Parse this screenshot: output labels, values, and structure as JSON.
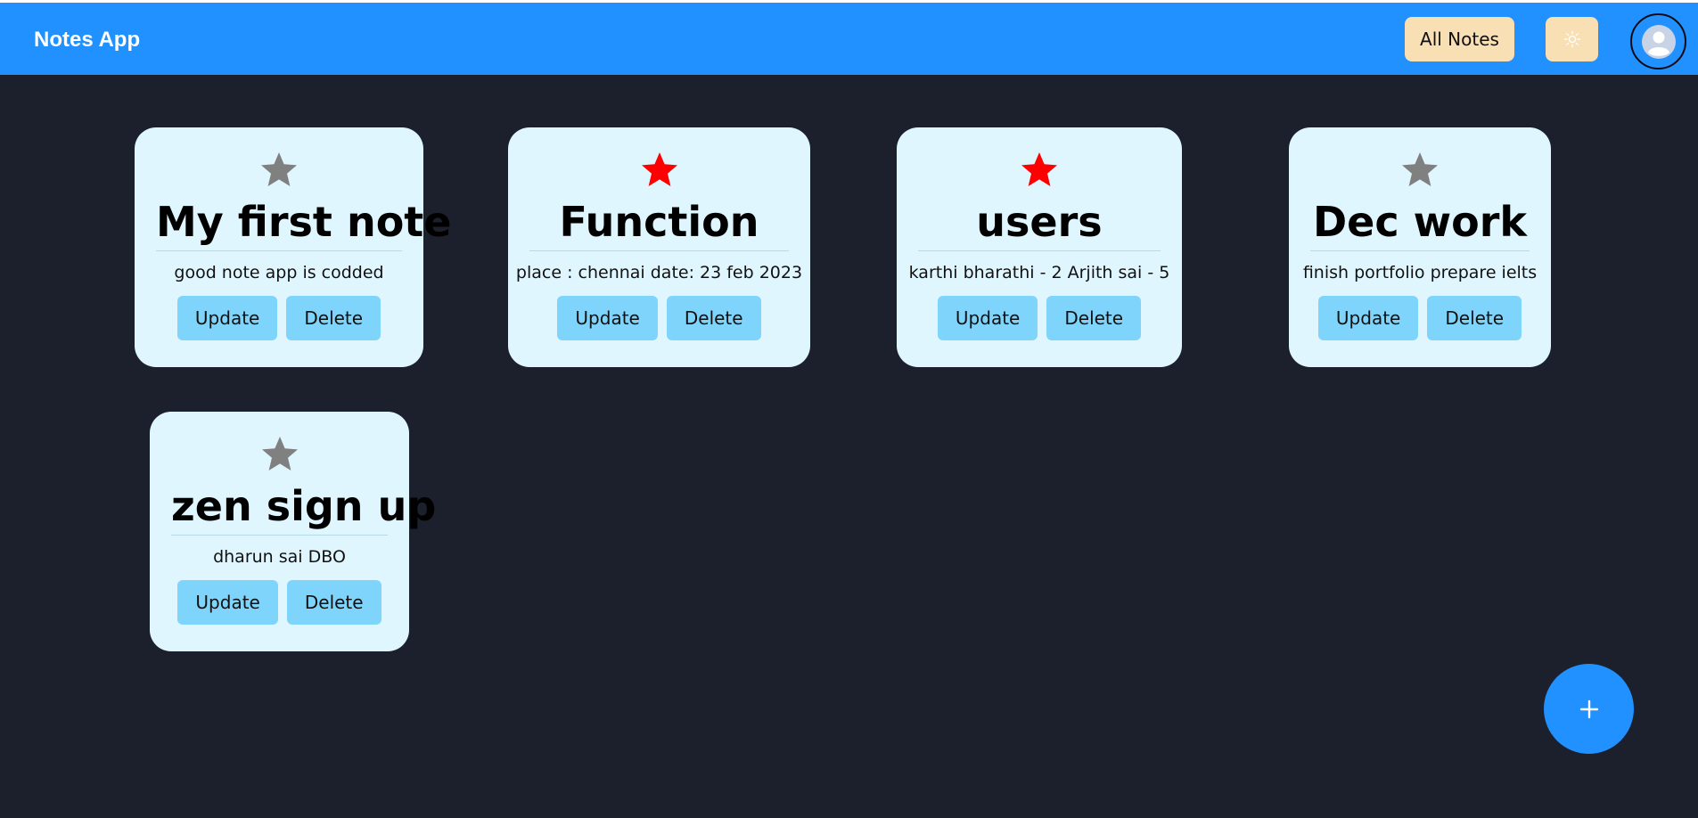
{
  "header": {
    "brand": "Notes App",
    "all_notes_label": "All Notes",
    "theme_icon": "sun-icon",
    "avatar_icon": "user-avatar-icon"
  },
  "notes": [
    {
      "title": "My first note",
      "description": "good note app is codded",
      "starred": false,
      "update_label": "Update",
      "delete_label": "Delete"
    },
    {
      "title": "Function",
      "description": "place : chennai date: 23 feb 2023",
      "starred": true,
      "update_label": "Update",
      "delete_label": "Delete"
    },
    {
      "title": "users",
      "description": "karthi bharathi - 2 Arjith sai - 5",
      "starred": true,
      "update_label": "Update",
      "delete_label": "Delete"
    },
    {
      "title": "Dec work",
      "description": "finish portfolio prepare ielts",
      "starred": false,
      "update_label": "Update",
      "delete_label": "Delete"
    },
    {
      "title": "zen sign up",
      "description": "dharun sai DBO",
      "starred": false,
      "update_label": "Update",
      "delete_label": "Delete"
    }
  ],
  "fab": {
    "label": "+",
    "icon": "plus-icon"
  },
  "colors": {
    "navbar": "#2191ff",
    "background": "#1b202c",
    "card": "#e0f6ff",
    "action_button": "#7fd4fb",
    "nav_button": "#f8dfb4",
    "star_active": "#ff0000",
    "star_inactive": "#808080"
  }
}
